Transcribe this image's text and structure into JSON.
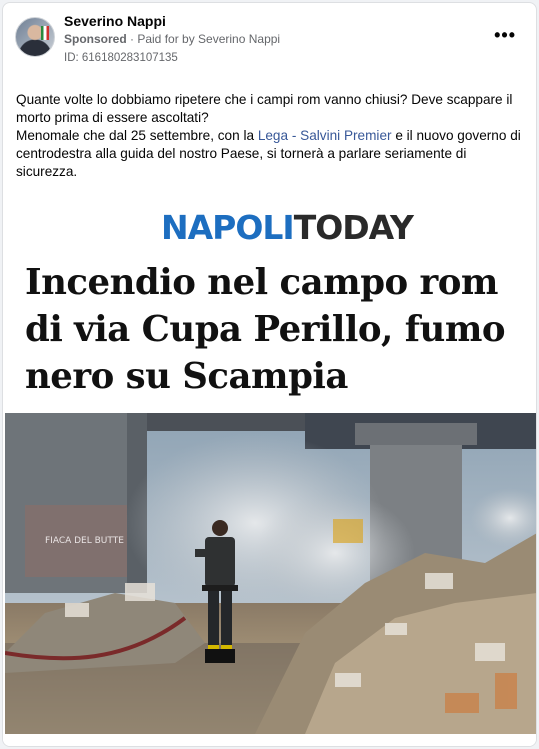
{
  "post": {
    "author": "Severino Nappi",
    "sponsored_label": "Sponsored",
    "paid_for": " · Paid for by Severino Nappi",
    "ad_id": "ID: 616180283107135",
    "more_icon": "more-options-icon"
  },
  "body": {
    "line1": "Quante volte lo dobbiamo ripetere che i campi rom vanno chiusi? Deve scappare il morto prima di essere ascoltati?",
    "line2_before": "Menomale che dal 25 settembre, con la ",
    "link1": "Lega - Salvini Premier",
    "line2_after": " e il nuovo governo di centrodestra alla guida del nostro Paese, si tornerà a parlare seriamente di sicurezza."
  },
  "media": {
    "logo_part1": "NAPOLI",
    "logo_part2": "TODAY",
    "headline": "Incendio nel campo rom di via Cupa Perillo, fumo nero su Scampia",
    "graffiti": "FIACA DEL BUTTE"
  },
  "colors": {
    "brand_blue": "#1d6ec0",
    "link": "#385898",
    "meta_gray": "#65676b"
  }
}
